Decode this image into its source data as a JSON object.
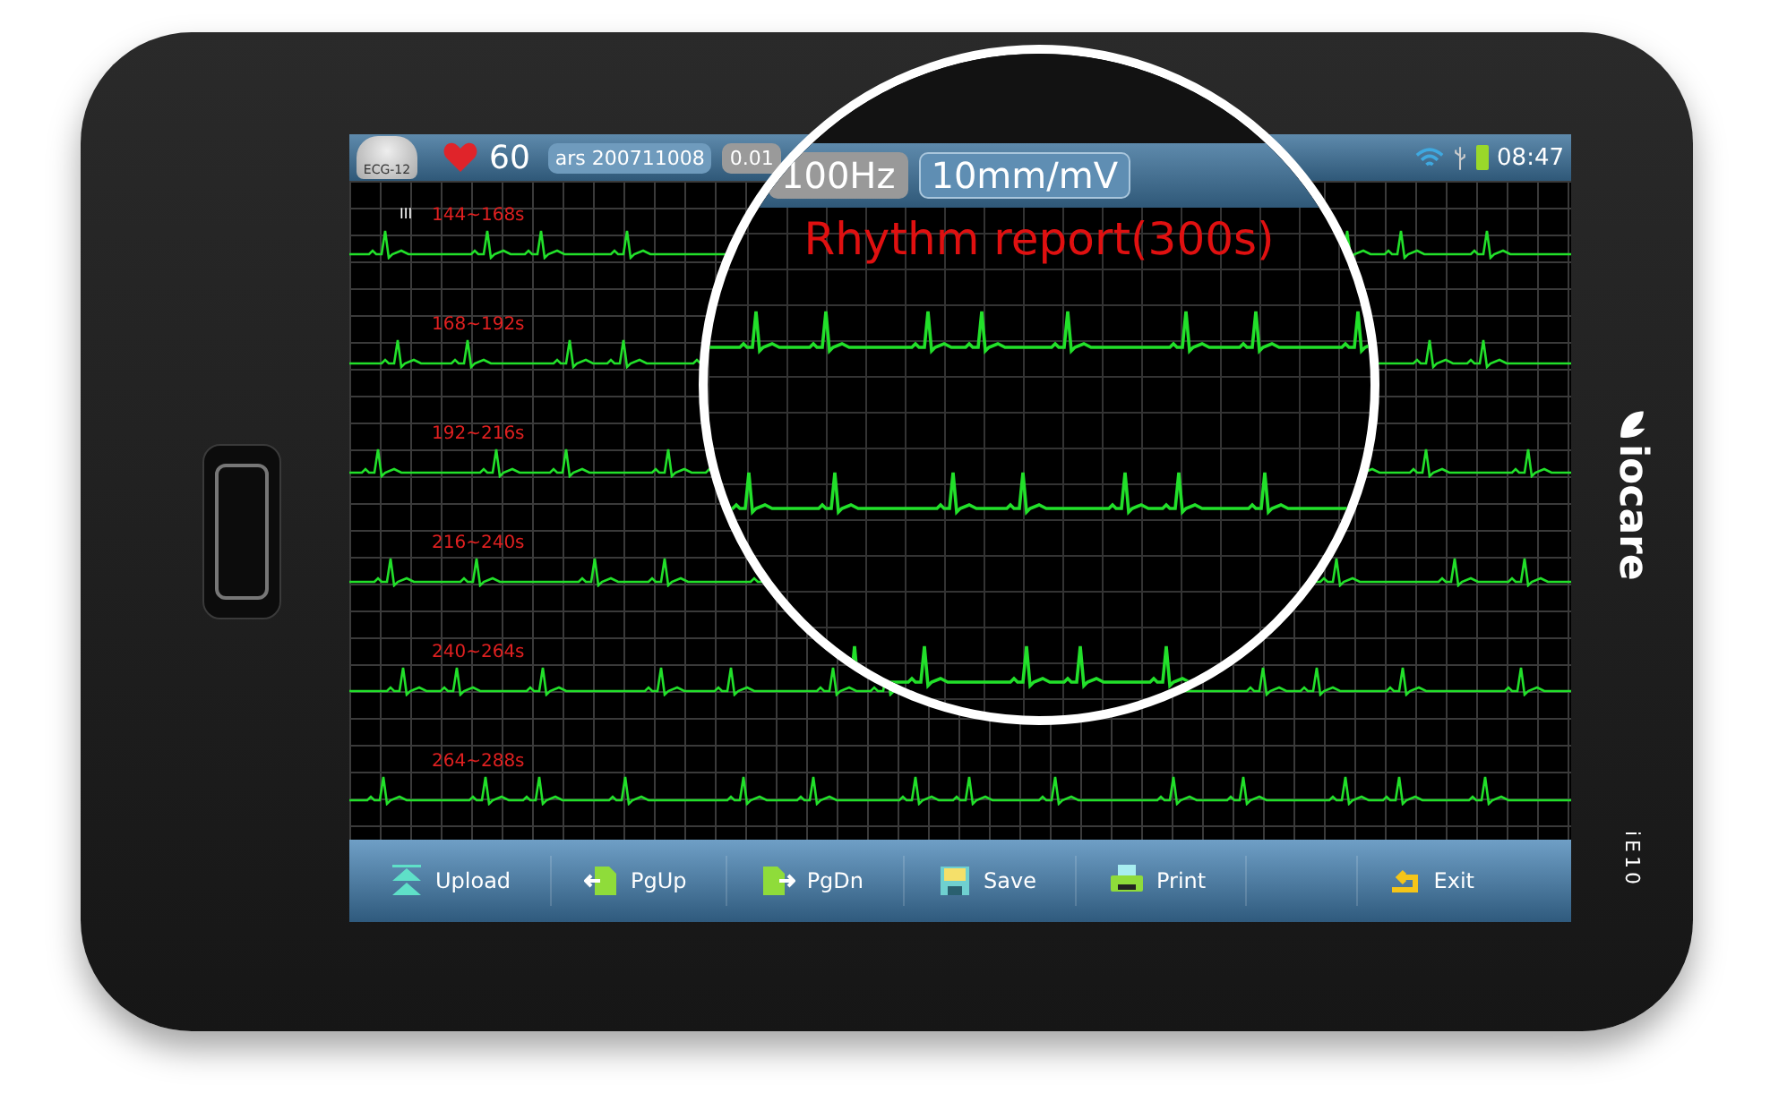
{
  "status_bar": {
    "mode_label": "ECG-12",
    "heart_rate": "60",
    "patient_id": "ars 200711008",
    "filter_low": "0.01",
    "time": "08:47"
  },
  "strips": [
    {
      "label": "144~168s",
      "lead": "III"
    },
    {
      "label": "168~192s"
    },
    {
      "label": "192~216s"
    },
    {
      "label": "216~240s"
    },
    {
      "label": "240~264s"
    },
    {
      "label": "264~288s"
    }
  ],
  "magnifier": {
    "filter_high": "100Hz",
    "gain": "10mm/mV",
    "title": "Rhythm report(300s)"
  },
  "toolbar": [
    {
      "label": "Upload",
      "kind": "upload"
    },
    {
      "label": "PgUp",
      "kind": "page-up"
    },
    {
      "label": "PgDn",
      "kind": "page-down"
    },
    {
      "label": "Save",
      "kind": "save"
    },
    {
      "label": "Print",
      "kind": "print"
    },
    {
      "label": "Exit",
      "kind": "exit"
    }
  ],
  "device": {
    "brand": "iocare",
    "model": "iE10"
  }
}
